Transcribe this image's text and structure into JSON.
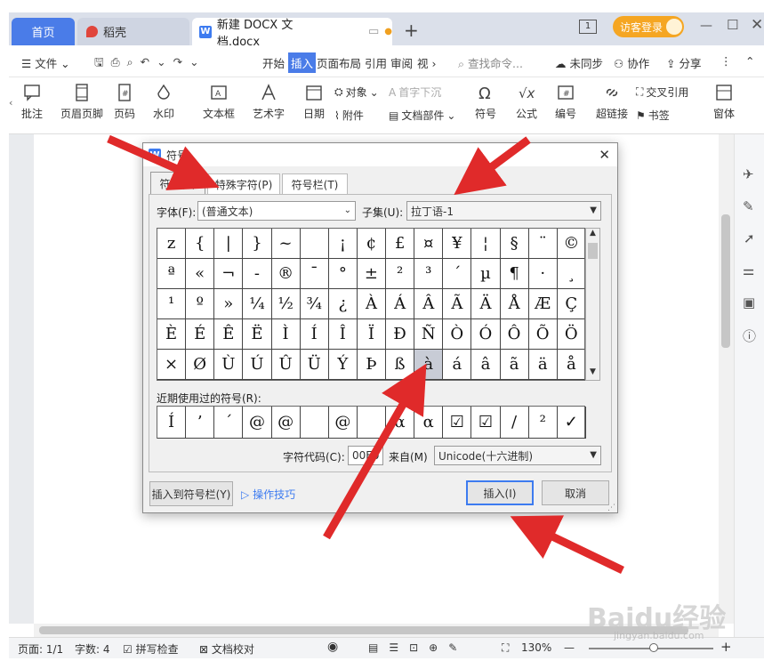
{
  "tabs": {
    "home": "首页",
    "docer": "稻壳",
    "doc": "新建 DOCX 文档.docx",
    "login": "访客登录"
  },
  "menu": {
    "file": "文件",
    "start": "开始",
    "insert": "插入",
    "layout": "页面布局",
    "ref": "引用",
    "review": "审阅",
    "view": "视",
    "search": "查找命令...",
    "unsync": "未同步",
    "collab": "协作",
    "share": "分享"
  },
  "ribbon": {
    "comment": "批注",
    "header_footer": "页眉页脚",
    "page_num": "页码",
    "watermark": "水印",
    "textbox": "文本框",
    "art": "艺术字",
    "date": "日期",
    "object": "对象",
    "attach": "附件",
    "dropcap": "首字下沉",
    "docpart": "文档部件",
    "symbol": "符号",
    "formula": "公式",
    "number": "编号",
    "hyperlink": "超链接",
    "crossref": "交叉引用",
    "bookmark": "书签",
    "window": "窗体"
  },
  "dialog": {
    "title": "符号",
    "tab_symbol": "符号(S)",
    "tab_special": "特殊字符(P)",
    "tab_bar": "符号栏(T)",
    "font_label": "字体(F):",
    "font_value": "(普通文本)",
    "subset_label": "子集(U):",
    "subset_value": "拉丁语-1",
    "grid": [
      "z",
      "{",
      "|",
      "}",
      "~",
      "",
      "¡",
      "¢",
      "£",
      "¤",
      "¥",
      "¦",
      "§",
      "¨",
      "©",
      "ª",
      "«",
      "¬",
      "-",
      "®",
      "¯",
      "°",
      "±",
      "²",
      "³",
      "´",
      "µ",
      "¶",
      "·",
      "¸",
      "¹",
      "º",
      "»",
      "¼",
      "½",
      "¾",
      "¿",
      "À",
      "Á",
      "Â",
      "Ã",
      "Ä",
      "Å",
      "Æ",
      "Ç",
      "È",
      "É",
      "Ê",
      "Ë",
      "Ì",
      "Í",
      "Î",
      "Ï",
      "Ð",
      "Ñ",
      "Ò",
      "Ó",
      "Ô",
      "Õ",
      "Ö",
      "×",
      "Ø",
      "Ù",
      "Ú",
      "Û",
      "Ü",
      "Ý",
      "Þ",
      "ß",
      "à",
      "á",
      "â",
      "ã",
      "ä",
      "å"
    ],
    "recent_label": "近期使用过的符号(R):",
    "recent": [
      "Í",
      "’",
      "´",
      "@",
      "@",
      "",
      "@",
      "",
      "α",
      "α",
      "☑",
      "☑",
      "/",
      "²",
      "✓"
    ],
    "code_label": "字符代码(C):",
    "code_value": "00E0",
    "from_label": "来自(M)",
    "from_value": "Unicode(十六进制)",
    "add_to_bar": "插入到符号栏(Y)",
    "tips": "操作技巧",
    "insert": "插入(I)",
    "cancel": "取消"
  },
  "status": {
    "page": "页面: 1/1",
    "words": "字数: 4",
    "spell": "拼写检查",
    "proof": "文档校对",
    "zoom": "130%"
  },
  "watermark": "Baidu经验",
  "watermark_url": "jingyan.baidu.com",
  "colors": {
    "accent": "#4a7ce8",
    "arrow": "#e02a2a",
    "login": "#f5a623"
  }
}
